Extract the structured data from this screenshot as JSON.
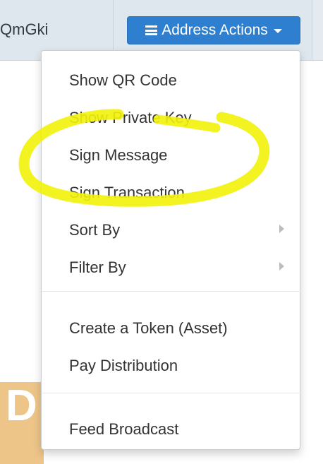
{
  "header": {
    "address_fragment": "QmGki",
    "actions_button_label": "Address Actions"
  },
  "menu": {
    "items": [
      {
        "label": "Show QR Code",
        "submenu": false
      },
      {
        "label": "Show Private Key",
        "submenu": false
      },
      {
        "label": "Sign Message",
        "submenu": false
      },
      {
        "label": "Sign Transaction",
        "submenu": false
      },
      {
        "label": "Sort By",
        "submenu": true
      },
      {
        "label": "Filter By",
        "submenu": true
      },
      {
        "label": "Create a Token (Asset)",
        "submenu": false
      },
      {
        "label": "Pay Distribution",
        "submenu": false
      },
      {
        "label": "Feed Broadcast",
        "submenu": false
      }
    ]
  },
  "background": {
    "thumbnail_letter": "D"
  },
  "colors": {
    "accent_button": "#2f7fd1",
    "highlight": "#f2f20a",
    "header_bg": "#dfe7ee",
    "thumbnail_bg": "#edc588"
  },
  "icons": [
    "hamburger-icon",
    "caret-down-icon",
    "chevron-right-icon"
  ]
}
